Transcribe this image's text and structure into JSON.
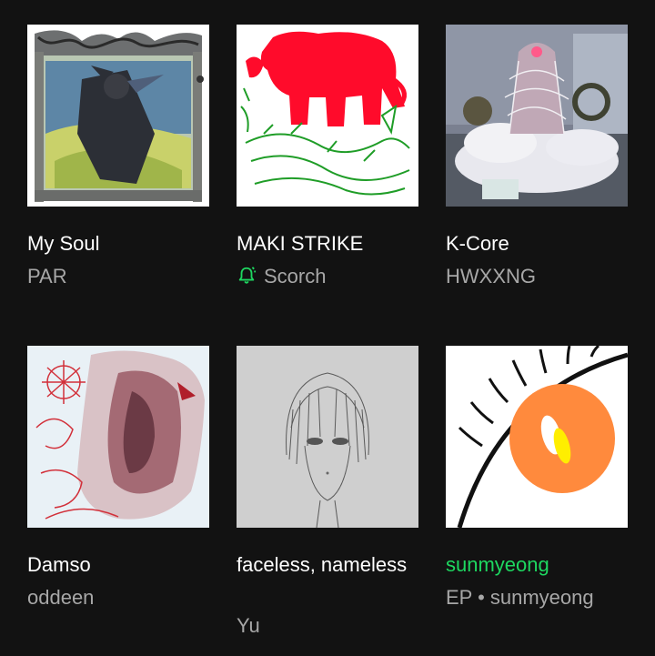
{
  "items": [
    {
      "title": "My Soul",
      "subtitle": "PAR",
      "art": "illustrated-warrior-art"
    },
    {
      "title": "MAKI STRIKE",
      "subtitle": "Scorch",
      "art": "red-elephant-green-crocodiles-art",
      "subtitle_icon": "new-release-bell-icon",
      "accent": "#1ed760"
    },
    {
      "title": "K-Core",
      "subtitle": "HWXXNG",
      "art": "cables-and-smoke-photo-art"
    },
    {
      "title": "Damso",
      "subtitle": "oddeen",
      "art": "red-sketch-collage-art"
    },
    {
      "title": "faceless, nameless",
      "subtitle": "Yu",
      "art": "pencil-face-sketch-art"
    },
    {
      "title": "sunmyeong",
      "subtitle": "EP • sunmyeong",
      "art": "orange-eye-art",
      "title_color": "#1ed760"
    }
  ],
  "colors": {
    "background": "#121212",
    "title": "#ffffff",
    "subtitle": "#a7a7a7",
    "accent": "#1ed760"
  }
}
